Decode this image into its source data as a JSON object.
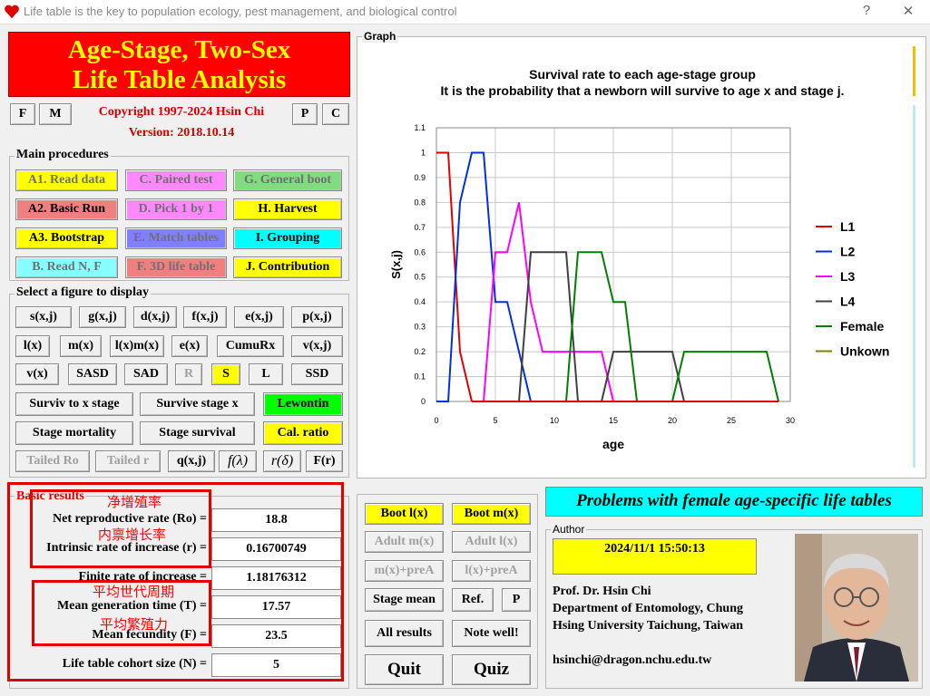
{
  "window": {
    "title": "Life table is the key to population ecology, pest management, and biological control",
    "help": "?",
    "close": "✕"
  },
  "app_title": {
    "line1": "Age-Stage, Two-Sex",
    "line2": "Life Table Analysis"
  },
  "top_buttons": {
    "f": "F",
    "m": "M",
    "p": "P",
    "c": "C"
  },
  "copyright": "Copyright 1997-2024 Hsin Chi",
  "version": "Version: 2018.10.14",
  "main_procedures": {
    "title": "Main procedures",
    "buttons": [
      {
        "label": "A1. Read data",
        "color": "#ffff00"
      },
      {
        "label": "C. Paired test",
        "color": "#ff88ff"
      },
      {
        "label": "G. General boot",
        "color": "#7fdc7f"
      },
      {
        "label": "A2. Basic Run",
        "color": "#f08080"
      },
      {
        "label": "D. Pick 1 by 1",
        "color": "#ff88ff"
      },
      {
        "label": "H. Harvest",
        "color": "#ffff00"
      },
      {
        "label": "A3. Bootstrap",
        "color": "#ffff00"
      },
      {
        "label": "E. Match tables",
        "color": "#8080ff"
      },
      {
        "label": "I. Grouping",
        "color": "#00ffff"
      },
      {
        "label": "B. Read N, F",
        "color": "#88ffff"
      },
      {
        "label": "F. 3D life table",
        "color": "#f08080"
      },
      {
        "label": "J. Contribution",
        "color": "#ffff00"
      }
    ]
  },
  "figure_select": {
    "title": "Select a figure to display",
    "row1": [
      "s(x,j)",
      "g(x,j)",
      "d(x,j)",
      "f(x,j)",
      "e(x,j)",
      "p(x,j)"
    ],
    "row2": [
      "l(x)",
      "m(x)",
      "l(x)m(x)",
      "e(x)",
      "CumuRx",
      "v(x,j)"
    ],
    "row3": [
      "v(x)",
      "SASD",
      "SAD",
      "R",
      "S",
      "L",
      "SSD"
    ],
    "surviv_x_stage": "Surviv to x stage",
    "survive_stage_x": "Survive stage x",
    "lewontin": "Lewontin",
    "stage_mortality": "Stage mortality",
    "stage_survival": "Stage survival",
    "cal_ratio": "Cal. ratio",
    "row6": [
      "Tailed Ro",
      "Tailed r",
      "q(x,j)",
      "f(λ)",
      "r(δ)",
      "F(r)"
    ]
  },
  "basic_results": {
    "title": "Basic results",
    "rows": [
      {
        "label": "Net reproductive rate (Ro) =",
        "value": "18.8"
      },
      {
        "label": "Intrinsic rate of increase (r) =",
        "value": "0.16700749"
      },
      {
        "label": "Finite rate of increase =",
        "value": "1.18176312"
      },
      {
        "label": "Mean generation time (T) =",
        "value": "17.57"
      },
      {
        "label": "Mean fecundity (F) =",
        "value": "23.5"
      },
      {
        "label": "Life table cohort size (N) =",
        "value": "5"
      }
    ],
    "notes": [
      "净增殖率",
      "内禀增长率",
      "平均世代周期",
      "平均繁殖力"
    ]
  },
  "mid_buttons": {
    "boot_lx": "Boot l(x)",
    "boot_mx": "Boot m(x)",
    "adult_mx": "Adult m(x)",
    "adult_lx": "Adult l(x)",
    "mx_prea": "m(x)+preA",
    "lx_prea": "l(x)+preA",
    "stage_mean": "Stage mean",
    "ref": "Ref.",
    "p": "P",
    "all_results": "All results",
    "note_well": "Note well!",
    "quit": "Quit",
    "quiz": "Quiz"
  },
  "problems_banner": "Problems with female age-specific life tables",
  "author": {
    "title": "Author",
    "datetime": "2024/11/1 15:50:13",
    "name": "Prof. Dr. Hsin Chi",
    "dept1": "Department of Entomology, Chung",
    "dept2": "Hsing University Taichung, Taiwan",
    "email": "hsinchi@dragon.nchu.edu.tw"
  },
  "graph_label": "Graph",
  "chart_data": {
    "type": "line",
    "title": "Survival rate to each age-stage group",
    "subtitle": "It is the probability that a newborn will survive to age x and stage j.",
    "xlabel": "age",
    "ylabel": "S(x,j)",
    "xlim": [
      0,
      30
    ],
    "ylim": [
      0,
      1.1
    ],
    "xticks": [
      0,
      5,
      10,
      15,
      20,
      25,
      30
    ],
    "yticks": [
      0,
      0.1,
      0.2,
      0.3,
      0.4,
      0.5,
      0.6,
      0.7,
      0.8,
      0.9,
      1,
      1.1
    ],
    "grid": true,
    "legend": "right",
    "series": [
      {
        "name": "L1",
        "color": "#e00000",
        "points": [
          [
            0,
            1
          ],
          [
            1,
            1
          ],
          [
            2,
            0.2
          ],
          [
            3,
            0
          ]
        ]
      },
      {
        "name": "L2",
        "color": "#0030e0",
        "points": [
          [
            0,
            0
          ],
          [
            1,
            0
          ],
          [
            2,
            0.8
          ],
          [
            3,
            1
          ],
          [
            4,
            1
          ],
          [
            5,
            0.4
          ],
          [
            6,
            0.4
          ],
          [
            7,
            0.2
          ],
          [
            8,
            0
          ]
        ]
      },
      {
        "name": "L3",
        "color": "#ff00ff",
        "points": [
          [
            3,
            0
          ],
          [
            4,
            0
          ],
          [
            5,
            0.6
          ],
          [
            6,
            0.6
          ],
          [
            7,
            0.8
          ],
          [
            8,
            0.4
          ],
          [
            9,
            0.2
          ],
          [
            14,
            0.2
          ],
          [
            15,
            0
          ]
        ]
      },
      {
        "name": "L4",
        "color": "#404040",
        "points": [
          [
            6,
            0
          ],
          [
            7,
            0
          ],
          [
            8,
            0.6
          ],
          [
            11,
            0.6
          ],
          [
            12,
            0
          ],
          [
            14,
            0
          ],
          [
            15,
            0.2
          ],
          [
            20,
            0.2
          ],
          [
            21,
            0
          ]
        ]
      },
      {
        "name": "Female",
        "color": "#008000",
        "points": [
          [
            11,
            0
          ],
          [
            12,
            0.6
          ],
          [
            14,
            0.6
          ],
          [
            15,
            0.4
          ],
          [
            16,
            0.4
          ],
          [
            17,
            0
          ],
          [
            20,
            0
          ],
          [
            21,
            0.2
          ],
          [
            28,
            0.2
          ],
          [
            29,
            0
          ]
        ]
      },
      {
        "name": "Unkown",
        "color": "#808000",
        "points": []
      }
    ]
  }
}
